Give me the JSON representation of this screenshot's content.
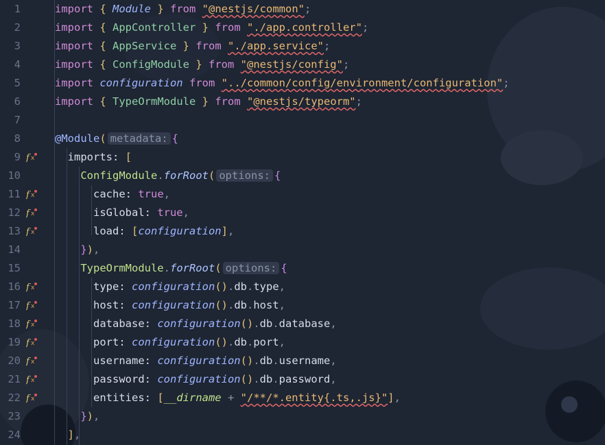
{
  "editor": {
    "language": "typescript",
    "lines": [
      {
        "n": "1",
        "g": "",
        "t": [
          [
            "kw",
            "import "
          ],
          [
            "br",
            "{ "
          ],
          [
            "it",
            "Module"
          ],
          [
            "br",
            " }"
          ],
          [
            "kw",
            " from "
          ],
          [
            "str",
            "\"@nestjs/common\""
          ],
          [
            "punc",
            ";"
          ]
        ]
      },
      {
        "n": "2",
        "g": "",
        "t": [
          [
            "kw",
            "import "
          ],
          [
            "br",
            "{ "
          ],
          [
            "id",
            "AppController"
          ],
          [
            "br",
            " }"
          ],
          [
            "kw",
            " from "
          ],
          [
            "str",
            "\"./app.controller\""
          ],
          [
            "punc",
            ";"
          ]
        ]
      },
      {
        "n": "3",
        "g": "",
        "t": [
          [
            "kw",
            "import "
          ],
          [
            "br",
            "{ "
          ],
          [
            "id",
            "AppService"
          ],
          [
            "br",
            " }"
          ],
          [
            "kw",
            " from "
          ],
          [
            "str",
            "\"./app.service\""
          ],
          [
            "punc",
            ";"
          ]
        ]
      },
      {
        "n": "4",
        "g": "",
        "t": [
          [
            "kw",
            "import "
          ],
          [
            "br",
            "{ "
          ],
          [
            "id",
            "ConfigModule"
          ],
          [
            "br",
            " }"
          ],
          [
            "kw",
            " from "
          ],
          [
            "str",
            "\"@nestjs/config\""
          ],
          [
            "punc",
            ";"
          ]
        ]
      },
      {
        "n": "5",
        "g": "",
        "t": [
          [
            "kw",
            "import "
          ],
          [
            "it",
            "configuration"
          ],
          [
            "kw",
            " from "
          ],
          [
            "str",
            "\"../common/config/environment/configuration\""
          ],
          [
            "punc",
            ";"
          ]
        ]
      },
      {
        "n": "6",
        "g": "",
        "t": [
          [
            "kw",
            "import "
          ],
          [
            "br",
            "{ "
          ],
          [
            "id",
            "TypeOrmModule"
          ],
          [
            "br",
            " }"
          ],
          [
            "kw",
            " from "
          ],
          [
            "str",
            "\"@nestjs/typeorm\""
          ],
          [
            "punc",
            ";"
          ]
        ]
      },
      {
        "n": "7",
        "g": "",
        "t": []
      },
      {
        "n": "8",
        "g": "",
        "t": [
          [
            "dec",
            "@Module"
          ],
          [
            "br",
            "("
          ],
          [
            "hint",
            "metadata:"
          ],
          [
            "br2",
            "{"
          ]
        ]
      },
      {
        "n": "9",
        "g": "fx",
        "t": [
          [
            "prop",
            "  imports: "
          ],
          [
            "br",
            "["
          ]
        ]
      },
      {
        "n": "10",
        "g": "",
        "t": [
          [
            "cls",
            "    ConfigModule"
          ],
          [
            "punc",
            "."
          ],
          [
            "fn",
            "forRoot"
          ],
          [
            "br",
            "("
          ],
          [
            "hint",
            "options:"
          ],
          [
            "br2",
            "{"
          ]
        ]
      },
      {
        "n": "11",
        "g": "fx",
        "t": [
          [
            "prop",
            "      cache: "
          ],
          [
            "lit",
            "true"
          ],
          [
            "punc",
            ","
          ]
        ]
      },
      {
        "n": "12",
        "g": "fx",
        "t": [
          [
            "prop",
            "      isGlobal: "
          ],
          [
            "lit",
            "true"
          ],
          [
            "punc",
            ","
          ]
        ]
      },
      {
        "n": "13",
        "g": "fx",
        "t": [
          [
            "prop",
            "      load: "
          ],
          [
            "br",
            "["
          ],
          [
            "it",
            "configuration"
          ],
          [
            "br",
            "]"
          ],
          [
            "punc",
            ","
          ]
        ]
      },
      {
        "n": "14",
        "g": "",
        "t": [
          [
            "br2",
            "    }"
          ],
          [
            "br",
            ")"
          ],
          [
            "punc",
            ","
          ]
        ]
      },
      {
        "n": "15",
        "g": "",
        "t": [
          [
            "cls",
            "    TypeOrmModule"
          ],
          [
            "punc",
            "."
          ],
          [
            "fn",
            "forRoot"
          ],
          [
            "br",
            "("
          ],
          [
            "hint",
            "options:"
          ],
          [
            "br2",
            "{"
          ]
        ]
      },
      {
        "n": "16",
        "g": "fx",
        "t": [
          [
            "prop",
            "      type: "
          ],
          [
            "it",
            "configuration"
          ],
          [
            "br",
            "()"
          ],
          [
            "punc",
            "."
          ],
          [
            "prop",
            "db"
          ],
          [
            "punc",
            "."
          ],
          [
            "prop",
            "type"
          ],
          [
            "punc",
            ","
          ]
        ]
      },
      {
        "n": "17",
        "g": "fx",
        "t": [
          [
            "prop",
            "      host: "
          ],
          [
            "it",
            "configuration"
          ],
          [
            "br",
            "()"
          ],
          [
            "punc",
            "."
          ],
          [
            "prop",
            "db"
          ],
          [
            "punc",
            "."
          ],
          [
            "prop",
            "host"
          ],
          [
            "punc",
            ","
          ]
        ]
      },
      {
        "n": "18",
        "g": "fx",
        "t": [
          [
            "prop",
            "      database: "
          ],
          [
            "it",
            "configuration"
          ],
          [
            "br",
            "()"
          ],
          [
            "punc",
            "."
          ],
          [
            "prop",
            "db"
          ],
          [
            "punc",
            "."
          ],
          [
            "prop",
            "database"
          ],
          [
            "punc",
            ","
          ]
        ]
      },
      {
        "n": "19",
        "g": "fx",
        "t": [
          [
            "prop",
            "      port: "
          ],
          [
            "it",
            "configuration"
          ],
          [
            "br",
            "()"
          ],
          [
            "punc",
            "."
          ],
          [
            "prop",
            "db"
          ],
          [
            "punc",
            "."
          ],
          [
            "prop",
            "port"
          ],
          [
            "punc",
            ","
          ]
        ]
      },
      {
        "n": "20",
        "g": "fx",
        "t": [
          [
            "prop",
            "      username: "
          ],
          [
            "it",
            "configuration"
          ],
          [
            "br",
            "()"
          ],
          [
            "punc",
            "."
          ],
          [
            "prop",
            "db"
          ],
          [
            "punc",
            "."
          ],
          [
            "prop",
            "username"
          ],
          [
            "punc",
            ","
          ]
        ]
      },
      {
        "n": "21",
        "g": "fx",
        "t": [
          [
            "prop",
            "      password: "
          ],
          [
            "it",
            "configuration"
          ],
          [
            "br",
            "()"
          ],
          [
            "punc",
            "."
          ],
          [
            "prop",
            "db"
          ],
          [
            "punc",
            "."
          ],
          [
            "prop",
            "password"
          ],
          [
            "punc",
            ","
          ]
        ]
      },
      {
        "n": "22",
        "g": "fx",
        "t": [
          [
            "prop",
            "      entities: "
          ],
          [
            "br",
            "["
          ],
          [
            "it2",
            "__dirname"
          ],
          [
            "punc",
            " + "
          ],
          [
            "str",
            "\"/**/*.entity{.ts,.js}\""
          ],
          [
            "br",
            "]"
          ],
          [
            "punc",
            ","
          ]
        ]
      },
      {
        "n": "23",
        "g": "",
        "t": [
          [
            "br2",
            "    }"
          ],
          [
            "br",
            ")"
          ],
          [
            "punc",
            ","
          ]
        ]
      },
      {
        "n": "24",
        "g": "",
        "t": [
          [
            "br",
            "  ]"
          ],
          [
            "punc",
            ","
          ]
        ]
      }
    ]
  }
}
